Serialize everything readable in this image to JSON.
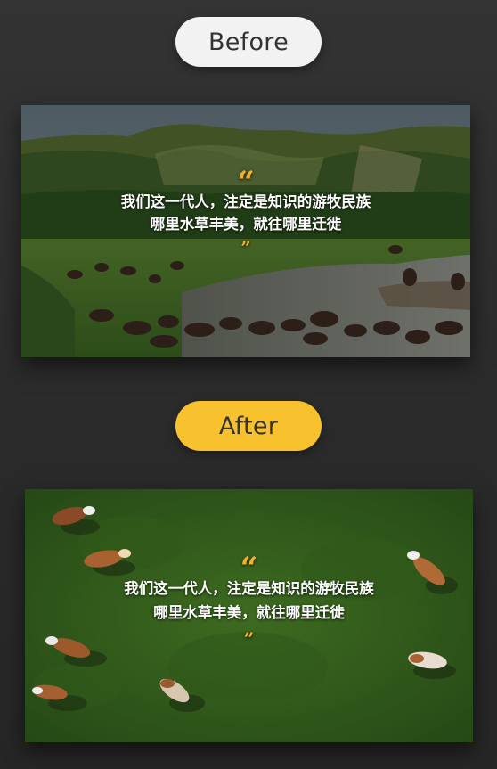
{
  "labels": {
    "before": "Before",
    "after": "After"
  },
  "quote": {
    "open_mark": "“",
    "close_mark": "”",
    "line1": "我们这一代人，注定是知识的游牧民族",
    "line2": "哪里水草丰美，就往哪里迁徙"
  },
  "colors": {
    "accent_yellow": "#f8c22f",
    "quote_mark": "#f3b12a",
    "pill_light": "#f2f2f2",
    "background": "#2d2d2d"
  },
  "images": {
    "before": "bison-herd-river-landscape",
    "after": "aerial-cattle-grass-field"
  }
}
